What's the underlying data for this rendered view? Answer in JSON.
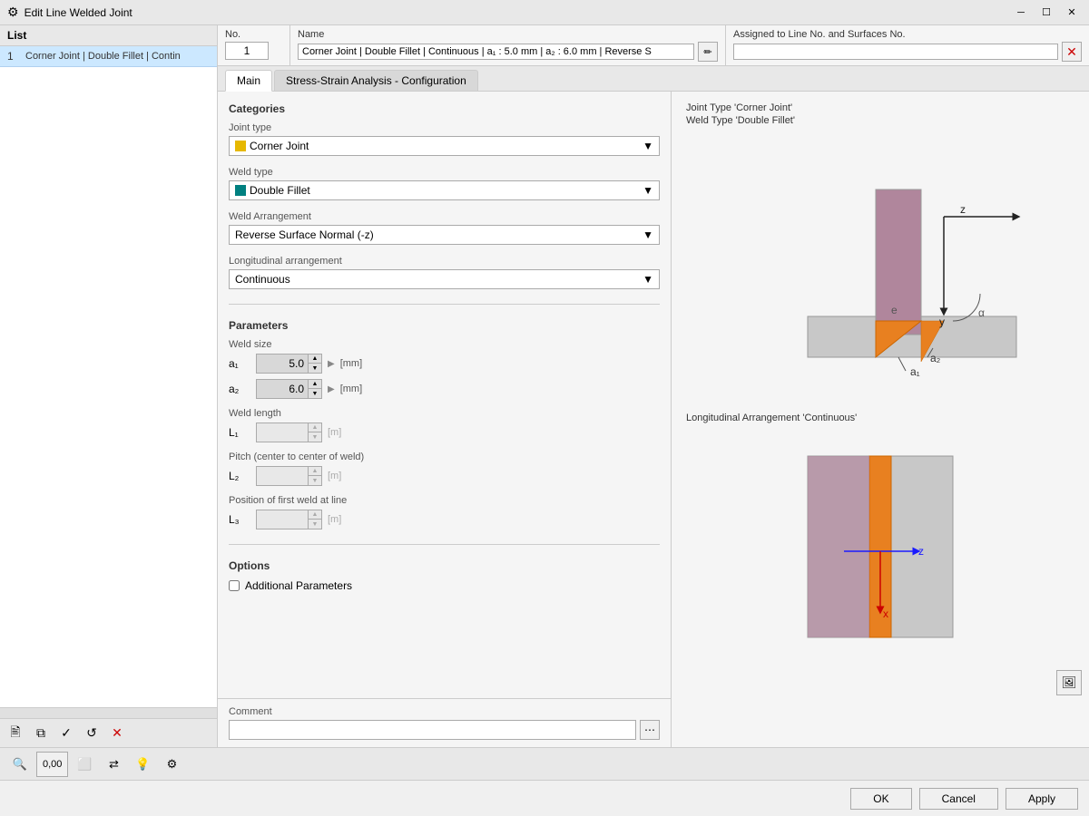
{
  "titleBar": {
    "title": "Edit Line Welded Joint",
    "icon": "⚙"
  },
  "list": {
    "label": "List",
    "items": [
      {
        "num": "1",
        "text": "Corner Joint | Double Fillet | Contin"
      }
    ]
  },
  "no": {
    "label": "No.",
    "value": "1"
  },
  "name": {
    "label": "Name",
    "value": "Corner Joint | Double Fillet | Continuous | a₁ : 5.0 mm | a₂ : 6.0 mm | Reverse S"
  },
  "assigned": {
    "label": "Assigned to Line No. and Surfaces No.",
    "value": "",
    "clearBtn": "✕"
  },
  "tabs": {
    "items": [
      {
        "id": "main",
        "label": "Main",
        "active": true
      },
      {
        "id": "stress",
        "label": "Stress-Strain Analysis - Configuration",
        "active": false
      }
    ]
  },
  "categories": {
    "label": "Categories",
    "jointType": {
      "label": "Joint type",
      "value": "Corner Joint",
      "color": "#e6b800"
    },
    "weldType": {
      "label": "Weld type",
      "value": "Double Fillet",
      "color": "#008080"
    },
    "weldArrangement": {
      "label": "Weld Arrangement",
      "value": "Reverse Surface Normal (-z)"
    },
    "longitudinalArrangement": {
      "label": "Longitudinal arrangement",
      "value": "Continuous"
    }
  },
  "parameters": {
    "label": "Parameters",
    "weldSize": {
      "label": "Weld size",
      "a1": {
        "label": "a₁",
        "value": "5.0",
        "unit": "[mm]"
      },
      "a2": {
        "label": "a₂",
        "value": "6.0",
        "unit": "[mm]"
      }
    },
    "weldLength": {
      "label": "Weld length",
      "l1": {
        "label": "L₁",
        "value": "",
        "unit": "[m]",
        "disabled": true
      }
    },
    "pitch": {
      "label": "Pitch (center to center of weld)",
      "l2": {
        "label": "L₂",
        "value": "",
        "unit": "[m]",
        "disabled": true
      }
    },
    "position": {
      "label": "Position of first weld at line",
      "l3": {
        "label": "L₃",
        "value": "",
        "unit": "[m]",
        "disabled": true
      }
    }
  },
  "options": {
    "label": "Options",
    "additionalParams": {
      "label": "Additional Parameters",
      "checked": false
    }
  },
  "diagram": {
    "topLabel1": "Joint Type 'Corner Joint'",
    "topLabel2": "Weld Type 'Double Fillet'",
    "bottomLabel": "Longitudinal Arrangement 'Continuous'"
  },
  "comment": {
    "label": "Comment",
    "value": "",
    "placeholder": ""
  },
  "bottomToolbar": {
    "tools": [
      "🔍",
      "0,00",
      "⬜",
      "⇄",
      "💡",
      "⚙"
    ]
  },
  "okCancel": {
    "ok": "OK",
    "cancel": "Cancel",
    "apply": "Apply"
  }
}
